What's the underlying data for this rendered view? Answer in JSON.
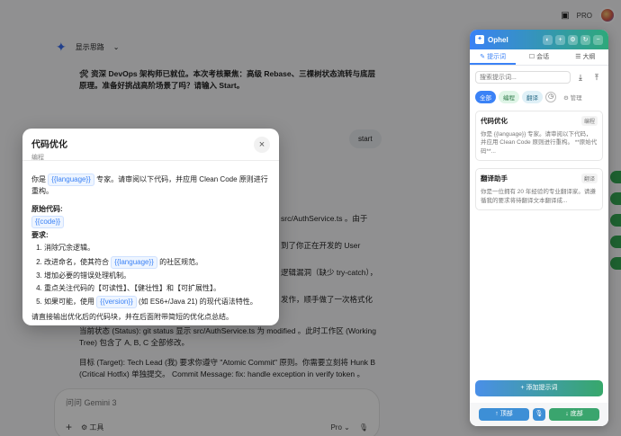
{
  "topbar": {
    "pro_label": "PRO"
  },
  "gemini": {
    "header_label": "显示思路",
    "intro": "🛠 资深 DevOps 架构师已就位。本次考核聚焦：高级 Rebase、三棵树状态流转与底层原理。准备好挑战高阶场景了吗？请输入 Start。",
    "user_message": "start",
    "frag1": "src/AuthService.ts 。由于",
    "frag2": "到了你正在开发的 User",
    "frag3": "逻辑漏洞（缺少 try-catch），",
    "frag4": "发作，顺手做了一次格式化",
    "status_line": "当前状态 (Status): git status 显示 src/AuthService.ts 为 modified 。此时工作区 (Working Tree) 包含了 A, B, C 全部修改。",
    "target_line": "目标 (Target): Tech Lead (我) 要求你遵守 \"Atomic Commit\" 原则。你需要立刻将 Hunk B (Critical Hotfix) 单独提交。 Commit Message: fix: handle exception in verify token 。",
    "input_placeholder": "问问 Gemini 3",
    "tools_label": "工具",
    "model_label": "Pro"
  },
  "modal": {
    "title": "代码优化",
    "subtitle": "编程",
    "line1_pre": "你是",
    "line1_var": "{{language}}",
    "line1_post": "专家。请审阅以下代码，并应用 Clean Code 原则进行重构。",
    "code_label": "原始代码:",
    "code_var": "{{code}}",
    "req_label": "要求:",
    "req1": "消除冗余逻辑。",
    "req2_pre": "改进命名，使其符合",
    "req2_var": "{{language}}",
    "req2_post": "的社区规范。",
    "req3": "增加必要的错误处理机制。",
    "req4": "重点关注代码的【可读性】、【健壮性】和【可扩展性】。",
    "req5_pre": "如果可能，使用",
    "req5_var": "{{version}}",
    "req5_post": "(如 ES6+/Java 21) 的现代语法特性。",
    "closing": "请直接输出优化后的代码块，并在后面附带简短的优化点总结。"
  },
  "panel": {
    "name": "Ophel",
    "tabs": [
      "提示词",
      "会话",
      "大纲"
    ],
    "search_placeholder": "搜索提示词...",
    "filters": [
      "全部",
      "编程",
      "翻译"
    ],
    "manage_label": "管理",
    "cards": [
      {
        "title": "代码优化",
        "tag": "编程",
        "desc": "你是 {{language}} 专家。请审阅以下代码，并应用 Clean Code 原则进行重构。 **原始代码**..."
      },
      {
        "title": "翻译助手",
        "tag": "翻译",
        "desc": "你是一位拥有 20 年经验的专业翻译家。请遵循我的要求将待翻译文本翻译成..."
      }
    ],
    "add_label": "+ 添加提示词",
    "top_label": "↑ 顶部",
    "bottom_label": "↓ 底部"
  }
}
